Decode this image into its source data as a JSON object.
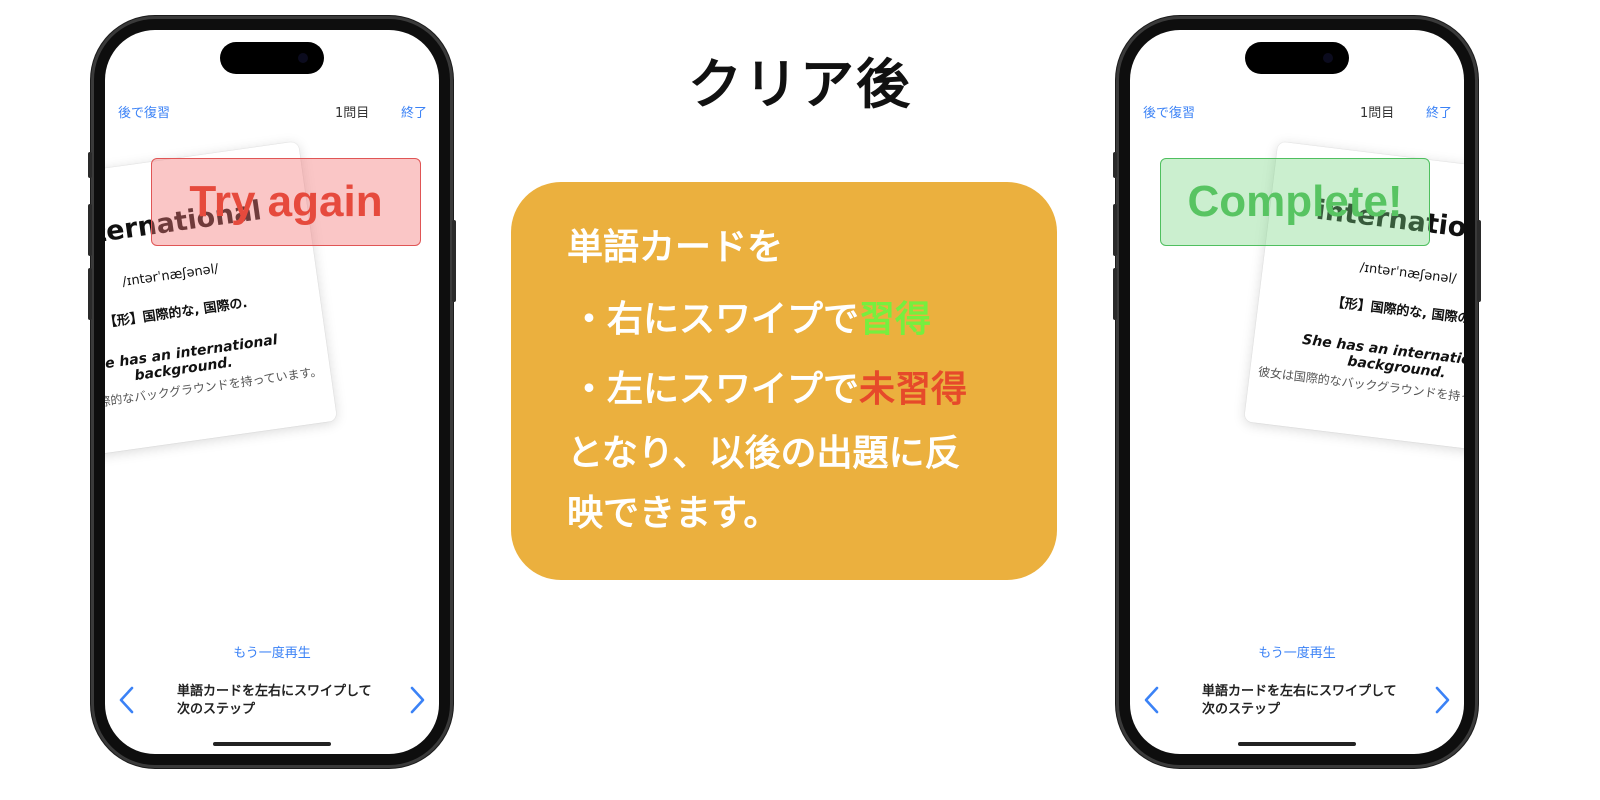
{
  "title": "クリア後",
  "colors": {
    "panel_bg": "#ebb03e",
    "learned": "#76ef3e",
    "unlearned": "#e64a2a",
    "link_blue": "#3b82f6"
  },
  "phone_common": {
    "nav_left": "後で復習",
    "nav_center": "1問目",
    "nav_right": "終了",
    "replay": "もう一度再生",
    "hint": "単語カードを左右にスワイプして次のステップ",
    "prev_icon": "chevron-left-icon",
    "next_icon": "chevron-right-icon"
  },
  "card": {
    "word": "international",
    "phonetic": "/ɪntərˈnæʃənəl/",
    "meaning": "【形】国際的な, 国際の.",
    "example": "She has an international background.",
    "translation": "彼女は国際的なバックグラウンドを持っています。"
  },
  "left_phone": {
    "stamp": "Try again"
  },
  "right_phone": {
    "stamp": "Complete!"
  },
  "panel": {
    "line1": "単語カードを",
    "line2_prefix": "・右にスワイプで",
    "line2_highlight": "習得",
    "line3_prefix": "・左にスワイプで",
    "line3_highlight": "未習得",
    "line4": "となり、以後の出題に反",
    "line5": "映できます。"
  }
}
